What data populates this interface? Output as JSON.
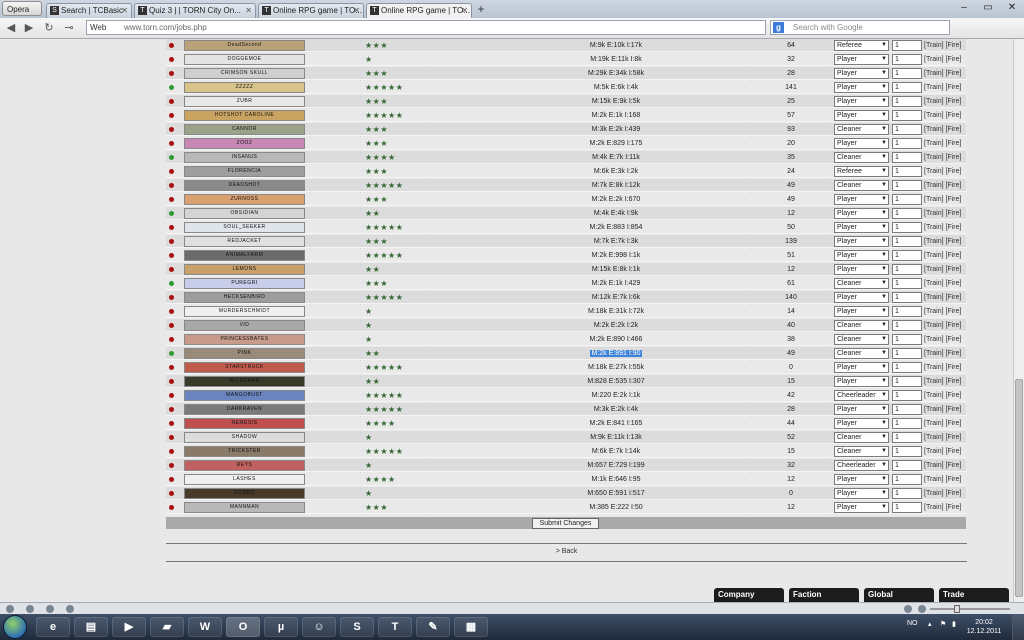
{
  "browser": {
    "menu_label": "Opera",
    "tabs": [
      {
        "title": "Search | TCBasic"
      },
      {
        "title": "Quiz 3 | | TORN City On..."
      },
      {
        "title": "Online RPG game | TO..."
      },
      {
        "title": "Online RPG game | TO..."
      }
    ],
    "address_prefix": "Web",
    "url": "www.torn.com/jobs.php",
    "search_placeholder": "Search with Google"
  },
  "jobs_table": {
    "rows": [
      {
        "banner": "DeadSecond",
        "stars": "★★★",
        "stats": "M:9k E:10k I:17k",
        "days": "64",
        "job": "Referee",
        "rate": "1",
        "online": false
      },
      {
        "banner": "DOGGEMOE",
        "stars": "★",
        "stats": "M:19k E:11k I:8k",
        "days": "32",
        "job": "Player",
        "rate": "1",
        "online": false
      },
      {
        "banner": "CRIMSON SKULL",
        "stars": "★★★",
        "stats": "M:29k E:34k I:58k",
        "days": "28",
        "job": "Player",
        "rate": "1",
        "online": false
      },
      {
        "banner": "ZZZZZ",
        "stars": "★★★★★",
        "stats": "M:5k E:6k I:4k",
        "days": "141",
        "job": "Player",
        "rate": "1",
        "online": true
      },
      {
        "banner": "ZUBR",
        "stars": "★★★",
        "stats": "M:15k E:9k I:5k",
        "days": "25",
        "job": "Player",
        "rate": "1",
        "online": false
      },
      {
        "banner": "HOTSHOT CAROLINE",
        "stars": "★★★★★",
        "stats": "M:2k E:1k I:168",
        "days": "57",
        "job": "Player",
        "rate": "1",
        "online": false
      },
      {
        "banner": "CANNOR",
        "stars": "★★★",
        "stats": "M:3k E:2k I:439",
        "days": "93",
        "job": "Cleaner",
        "rate": "1",
        "online": false
      },
      {
        "banner": "ZOOZ",
        "stars": "★★★",
        "stats": "M:2k E:829 I:175",
        "days": "20",
        "job": "Player",
        "rate": "1",
        "online": false
      },
      {
        "banner": "INSANUS",
        "stars": "★★★★",
        "stats": "M:4k E:7k I:11k",
        "days": "35",
        "job": "Cleaner",
        "rate": "1",
        "online": true
      },
      {
        "banner": "FLORENCIA",
        "stars": "★★★",
        "stats": "M:6k E:3k I:2k",
        "days": "24",
        "job": "Referee",
        "rate": "1",
        "online": false
      },
      {
        "banner": "DEADSHOT",
        "stars": "★★★★★",
        "stats": "M:7k E:8k I:12k",
        "days": "49",
        "job": "Cleaner",
        "rate": "1",
        "online": false
      },
      {
        "banner": "ZURNOSS",
        "stars": "★★★",
        "stats": "M:2k E:2k I:670",
        "days": "49",
        "job": "Player",
        "rate": "1",
        "online": false
      },
      {
        "banner": "OBSIDIAN",
        "stars": "★★",
        "stats": "M:4k E:4k I:9k",
        "days": "12",
        "job": "Player",
        "rate": "1",
        "online": true
      },
      {
        "banner": "SOUL_SEEKER",
        "stars": "★★★★★",
        "stats": "M:2k E:883 I:854",
        "days": "50",
        "job": "Player",
        "rate": "1",
        "online": false
      },
      {
        "banner": "REDJACKET",
        "stars": "★★★",
        "stats": "M:7k E:7k I:3k",
        "days": "139",
        "job": "Player",
        "rate": "1",
        "online": false
      },
      {
        "banner": "ANIMALFARM",
        "stars": "★★★★★",
        "stats": "M:2k E:998 I:1k",
        "days": "51",
        "job": "Player",
        "rate": "1",
        "online": false
      },
      {
        "banner": "LEMONS",
        "stars": "★★",
        "stats": "M:15k E:8k I:1k",
        "days": "12",
        "job": "Player",
        "rate": "1",
        "online": false
      },
      {
        "banner": "PUREGRI",
        "stars": "★★★",
        "stats": "M:2k E:1k I:429",
        "days": "61",
        "job": "Cleaner",
        "rate": "1",
        "online": true
      },
      {
        "banner": "HECKSENBIRD",
        "stars": "★★★★★",
        "stats": "M:12k E:7k I:6k",
        "days": "140",
        "job": "Player",
        "rate": "1",
        "online": false
      },
      {
        "banner": "MURDERSCHMIDT",
        "stars": "★",
        "stats": "M:18k E:31k I:72k",
        "days": "14",
        "job": "Player",
        "rate": "1",
        "online": false
      },
      {
        "banner": "VID",
        "stars": "★",
        "stats": "M:2k E:2k I:2k",
        "days": "40",
        "job": "Cleaner",
        "rate": "1",
        "online": false
      },
      {
        "banner": "PRINCESSBATES",
        "stars": "★",
        "stats": "M:2k E:890 I:466",
        "days": "38",
        "job": "Cleaner",
        "rate": "1",
        "online": false
      },
      {
        "banner": "PINK",
        "stars": "★★",
        "stats": "M:2k E:891 I:90",
        "days": "49",
        "job": "Cleaner",
        "rate": "1",
        "online": true,
        "highlight": true
      },
      {
        "banner": "STARSTRUCK",
        "stars": "★★★★★",
        "stats": "M:18k E:27k I:55k",
        "days": "0",
        "job": "Player",
        "rate": "1",
        "online": false
      },
      {
        "banner": "WILDCARD",
        "stars": "★★",
        "stats": "M:828 E:535 I:307",
        "days": "15",
        "job": "Player",
        "rate": "1",
        "online": false
      },
      {
        "banner": "MANGOBUST",
        "stars": "★★★★★",
        "stats": "M:220 E:2k I:1k",
        "days": "42",
        "job": "Cheerleader",
        "rate": "1",
        "online": false
      },
      {
        "banner": "DARKRAVEN",
        "stars": "★★★★★",
        "stats": "M:3k E:2k I:4k",
        "days": "28",
        "job": "Player",
        "rate": "1",
        "online": false
      },
      {
        "banner": "NEMESIS",
        "stars": "★★★★",
        "stats": "M:2k E:841 I:165",
        "days": "44",
        "job": "Player",
        "rate": "1",
        "online": false
      },
      {
        "banner": "SHADOW",
        "stars": "★",
        "stats": "M:9k E:11k I:13k",
        "days": "52",
        "job": "Cleaner",
        "rate": "1",
        "online": false
      },
      {
        "banner": "TRICKSTER",
        "stars": "★★★★★",
        "stats": "M:6k E:7k I:14k",
        "days": "15",
        "job": "Cleaner",
        "rate": "1",
        "online": false
      },
      {
        "banner": "REYS",
        "stars": "★",
        "stats": "M:657 E:729 I:199",
        "days": "32",
        "job": "Cheerleader",
        "rate": "1",
        "online": false
      },
      {
        "banner": "LASHES",
        "stars": "★★★★",
        "stats": "M:1k E:646 I:95",
        "days": "12",
        "job": "Player",
        "rate": "1",
        "online": false
      },
      {
        "banner": "GOBBO",
        "stars": "★",
        "stats": "M:650 E:591 I:517",
        "days": "0",
        "job": "Player",
        "rate": "1",
        "online": false
      },
      {
        "banner": "MANNMAN",
        "stars": "★★★",
        "stats": "M:385 E:222 I:50",
        "days": "12",
        "job": "Player",
        "rate": "1",
        "online": false
      }
    ],
    "train_label": "[Train]",
    "fire_label": "[Fire]"
  },
  "submit_label": "Submit Changes",
  "back_label": "> Back",
  "chat_tabs": [
    "Company",
    "Faction",
    "Global",
    "Trade"
  ],
  "taskbar": {
    "language": "NO",
    "time": "20:02",
    "date": "12.12.2011"
  },
  "colors": {
    "online": "#2f9a2f",
    "offline": "#a80e0e",
    "highlight": "#3f84d8"
  }
}
